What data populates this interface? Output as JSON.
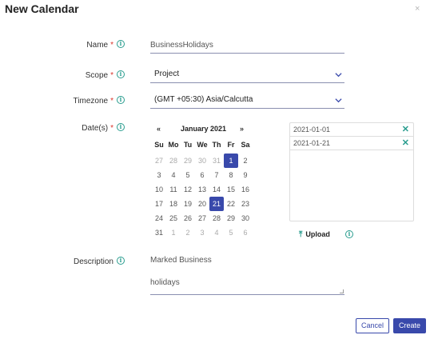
{
  "dialog": {
    "title": "New Calendar",
    "close": "×"
  },
  "info_glyph": "i",
  "required_marker": "*",
  "fields": {
    "name": {
      "label": "Name",
      "value": "BusinessHolidays"
    },
    "scope": {
      "label": "Scope",
      "value": "Project"
    },
    "timezone": {
      "label": "Timezone",
      "value": "(GMT +05:30) Asia/Calcutta"
    },
    "dates": {
      "label": "Date(s)"
    },
    "description": {
      "label": "Description",
      "value_line1": "Marked Business",
      "value_line2": "holidays"
    }
  },
  "chevron": "⌄",
  "calendar": {
    "month": "January 2021",
    "prev": "«",
    "next": "»",
    "weekdays": [
      "Su",
      "Mo",
      "Tu",
      "We",
      "Th",
      "Fr",
      "Sa"
    ],
    "weeks": [
      [
        "27",
        "28",
        "29",
        "30",
        "31",
        "1",
        "2"
      ],
      [
        "3",
        "4",
        "5",
        "6",
        "7",
        "8",
        "9"
      ],
      [
        "10",
        "11",
        "12",
        "13",
        "14",
        "15",
        "16"
      ],
      [
        "17",
        "18",
        "19",
        "20",
        "21",
        "22",
        "23"
      ],
      [
        "24",
        "25",
        "26",
        "27",
        "28",
        "29",
        "30"
      ],
      [
        "31",
        "1",
        "2",
        "3",
        "4",
        "5",
        "6"
      ]
    ],
    "selected": [
      "2021-01-01",
      "2021-01-21"
    ]
  },
  "selected_dates": [
    {
      "date": "2021-01-01",
      "remove": "✕"
    },
    {
      "date": "2021-01-21",
      "remove": "✕"
    }
  ],
  "upload": {
    "icon": "⤒",
    "label": "Upload"
  },
  "buttons": {
    "cancel": "Cancel",
    "create": "Create"
  },
  "colors": {
    "primary": "#3949ab",
    "accent": "#2a9d8f",
    "required": "#d9342b"
  }
}
